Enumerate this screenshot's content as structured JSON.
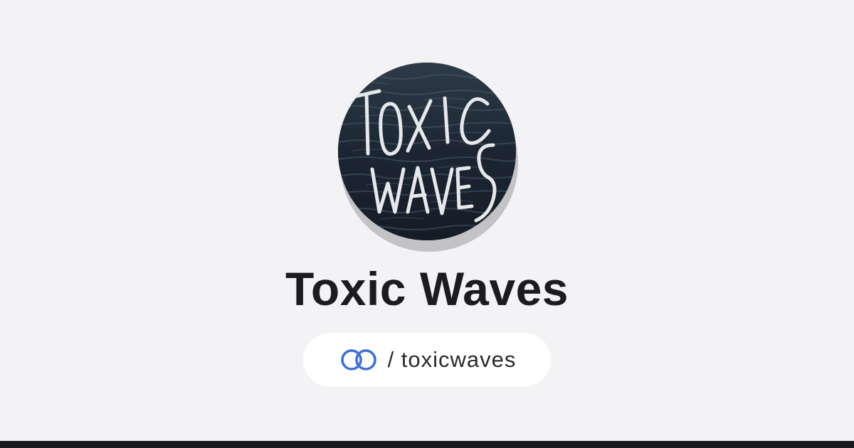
{
  "profile": {
    "name": "Toxic Waves",
    "handle": "/ toxicwaves",
    "avatar_text": "TOXIC WAVES"
  },
  "icons": {
    "link": "linked-rings-icon"
  },
  "colors": {
    "background": "#f3f3f5",
    "title": "#1c1c1e",
    "accent": "#3d6fd6",
    "pill": "#ffffff",
    "bottom_bar": "#1b1b1d"
  }
}
